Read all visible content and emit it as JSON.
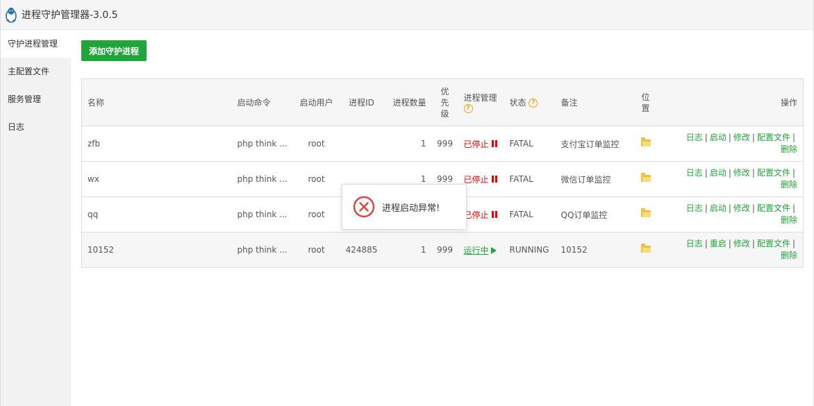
{
  "app": {
    "title": "进程守护管理器-3.0.5",
    "icon": "penguin-icon"
  },
  "sidebar": {
    "items": [
      {
        "label": "守护进程管理",
        "active": true
      },
      {
        "label": "主配置文件",
        "active": false
      },
      {
        "label": "服务管理",
        "active": false
      },
      {
        "label": "日志",
        "active": false
      }
    ]
  },
  "toolbar": {
    "add_label": "添加守护进程"
  },
  "table": {
    "headers": {
      "name": "名称",
      "command": "启动命令",
      "user": "启动用户",
      "pid": "进程ID",
      "count": "进程数量",
      "priority": "优先级",
      "management": "进程管理",
      "status": "状态",
      "remark": "备注",
      "location": "位置",
      "actions": "操作"
    },
    "rows": [
      {
        "name": "zfb",
        "command": "php think ...",
        "user": "root",
        "pid": "",
        "count": "1",
        "priority": "999",
        "state_text": "已停止",
        "state": "stopped",
        "status": "FATAL",
        "remark": "支付宝订单监控",
        "ops": [
          "日志",
          "启动",
          "修改",
          "配置文件",
          "删除"
        ]
      },
      {
        "name": "wx",
        "command": "php think ...",
        "user": "root",
        "pid": "",
        "count": "1",
        "priority": "999",
        "state_text": "已停止",
        "state": "stopped",
        "status": "FATAL",
        "remark": "微信订单监控",
        "ops": [
          "日志",
          "启动",
          "修改",
          "配置文件",
          "删除"
        ]
      },
      {
        "name": "qq",
        "command": "php think ...",
        "user": "root",
        "pid": "",
        "count": "",
        "priority": "",
        "state_text": "已停止",
        "state": "stopped",
        "status": "FATAL",
        "remark": "QQ订单监控",
        "ops": [
          "日志",
          "启动",
          "修改",
          "配置文件",
          "删除"
        ]
      },
      {
        "name": "10152",
        "command": "php think ...",
        "user": "root",
        "pid": "424885",
        "count": "1",
        "priority": "999",
        "state_text": "运行中",
        "state": "running",
        "status": "RUNNING",
        "remark": "10152",
        "ops": [
          "日志",
          "重启",
          "修改",
          "配置文件",
          "删除"
        ]
      }
    ]
  },
  "toast": {
    "message": "进程启动异常!",
    "icon": "error-circle-icon"
  },
  "colors": {
    "accent": "#20a53a",
    "stopped": "#ee0000",
    "help": "#f0a30a"
  }
}
